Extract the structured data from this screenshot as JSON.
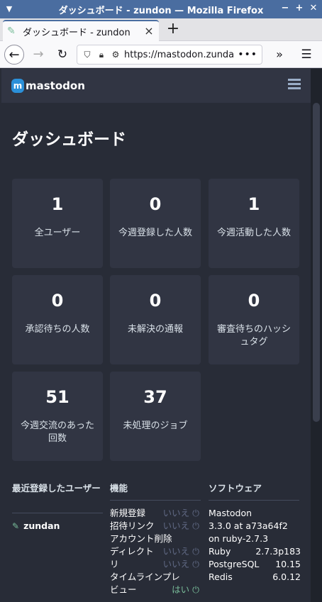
{
  "window": {
    "title": "ダッシュボード - zundon — Mozilla Firefox"
  },
  "tab": {
    "title": "ダッシュボード - zundon"
  },
  "nav": {
    "url": "https://mastodon.zunda.n"
  },
  "site": {
    "logo_text": "mastodon"
  },
  "page": {
    "title": "ダッシュボード"
  },
  "cards": [
    {
      "value": "1",
      "label": "全ユーザー"
    },
    {
      "value": "0",
      "label": "今週登録した人数"
    },
    {
      "value": "1",
      "label": "今週活動した人数"
    },
    {
      "value": "0",
      "label": "承認待ちの人数"
    },
    {
      "value": "0",
      "label": "未解決の通報"
    },
    {
      "value": "0",
      "label": "審査待ちのハッシュタグ"
    },
    {
      "value": "51",
      "label": "今週交流のあった回数"
    },
    {
      "value": "37",
      "label": "未処理のジョブ"
    }
  ],
  "recent_users": {
    "title": "最近登録したユーザー",
    "users": [
      "zundan"
    ]
  },
  "features": {
    "title": "機能",
    "rows": [
      {
        "name": "新規登録",
        "value": "いいえ"
      },
      {
        "name": "招待リンク",
        "value": "いいえ"
      },
      {
        "name": "アカウント削除",
        "value": ""
      },
      {
        "name": "ディレクトリ",
        "value": "いいえ"
      },
      {
        "name": "タイムラインプレビュー",
        "value": "はい"
      }
    ]
  },
  "software": {
    "title": "ソフトウェア",
    "mastodon": {
      "name": "Mastodon",
      "version": "3.3.0 at a73a64f2 on ruby-2.7.3"
    },
    "rows": [
      {
        "name": "Ruby",
        "value": "2.7.3p183"
      },
      {
        "name": "PostgreSQL",
        "value": "10.15"
      },
      {
        "name": "Redis",
        "value": "6.0.12"
      }
    ]
  }
}
